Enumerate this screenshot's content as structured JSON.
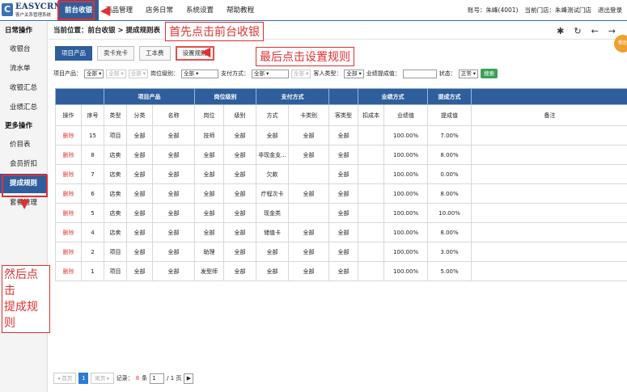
{
  "app": {
    "logo_mark": "C",
    "logo_title": "EASYCRM",
    "logo_sub": "客户关系管理系统"
  },
  "topnav": [
    "前台收银",
    "商品管理",
    "店务日常",
    "系统设置",
    "帮助教程"
  ],
  "account": {
    "user": "账号：朱峰(4001)",
    "store": "当前门店：朱峰测试门店",
    "logout": "退出登录"
  },
  "sidebar": {
    "group1": "日常操作",
    "items1": [
      "收银台",
      "流水单",
      "收银汇总",
      "业绩汇总"
    ],
    "group2": "更多操作",
    "items2": [
      "价目表",
      "会员折扣",
      "提成规则",
      "套餐管理"
    ]
  },
  "breadcrumb": "当前位置：前台收银 > 提成规则表",
  "icons": [
    "gear-icon",
    "refresh-icon",
    "back-icon",
    "forward-icon"
  ],
  "side_badge": "帮助",
  "tabs": [
    "项目产品",
    "卖卡充卡",
    "工本费",
    "设置规则"
  ],
  "filters": {
    "product_label": "项目产品：",
    "product_sel": "全部",
    "product_sel2": "全部",
    "product_sel3": "全部",
    "level_label": "岗位级别：",
    "level_sel": "全部",
    "pay_label": "支付方式：",
    "pay_sel": "全部",
    "pay_sel2": "全部",
    "customer_label": "客人类型：",
    "customer_sel": "全部",
    "perf_label": "业绩提成值：",
    "status_label": "状态：",
    "status_sel": "正常",
    "search": "搜索"
  },
  "table": {
    "groups": [
      "项目产品",
      "岗位级别",
      "支付方式",
      "业绩方式",
      "提成方式"
    ],
    "columns": [
      "操作",
      "序号",
      "类型",
      "分类",
      "名称",
      "岗位",
      "级别",
      "方式",
      "卡类别",
      "客类型",
      "扣成本",
      "业绩值",
      "提成值",
      "备注"
    ],
    "rows": [
      [
        "删除",
        "15",
        "项目",
        "全部",
        "全部",
        "技师",
        "全部",
        "全部",
        "全部",
        "全部",
        "",
        "100.00%",
        "7.00%",
        ""
      ],
      [
        "删除",
        "8",
        "店卖",
        "全部",
        "全部",
        "全部",
        "全部",
        "非现金支...",
        "全部",
        "全部",
        "",
        "100.00%",
        "8.00%",
        ""
      ],
      [
        "删除",
        "7",
        "店卖",
        "全部",
        "全部",
        "全部",
        "全部",
        "欠款",
        "",
        "全部",
        "",
        "100.00%",
        "0.00%",
        ""
      ],
      [
        "删除",
        "6",
        "店卖",
        "全部",
        "全部",
        "全部",
        "全部",
        "疗程次卡",
        "全部",
        "全部",
        "",
        "100.00%",
        "8.00%",
        ""
      ],
      [
        "删除",
        "5",
        "店卖",
        "全部",
        "全部",
        "全部",
        "全部",
        "现金类",
        "",
        "全部",
        "",
        "100.00%",
        "10.00%",
        ""
      ],
      [
        "删除",
        "4",
        "店卖",
        "全部",
        "全部",
        "全部",
        "全部",
        "储值卡",
        "全部",
        "全部",
        "",
        "100.00%",
        "8.00%",
        ""
      ],
      [
        "删除",
        "2",
        "项目",
        "全部",
        "全部",
        "助理",
        "全部",
        "全部",
        "全部",
        "全部",
        "",
        "100.00%",
        "3.00%",
        ""
      ],
      [
        "删除",
        "1",
        "项目",
        "全部",
        "全部",
        "发型师",
        "全部",
        "全部",
        "全部",
        "全部",
        "",
        "100.00%",
        "5.00%",
        ""
      ]
    ]
  },
  "pager": {
    "first": "◂ 首页",
    "page": "1",
    "last": "尾页 ▸",
    "records_label": "记录：",
    "records": "8",
    "records_unit": "条",
    "page_input": "1",
    "total_pages": "/ 1 页",
    "go": "▶"
  },
  "annotations": {
    "first": "首先点击前台收银",
    "last": "最后点击设置规则",
    "then": "然后点击\n提成规则"
  }
}
